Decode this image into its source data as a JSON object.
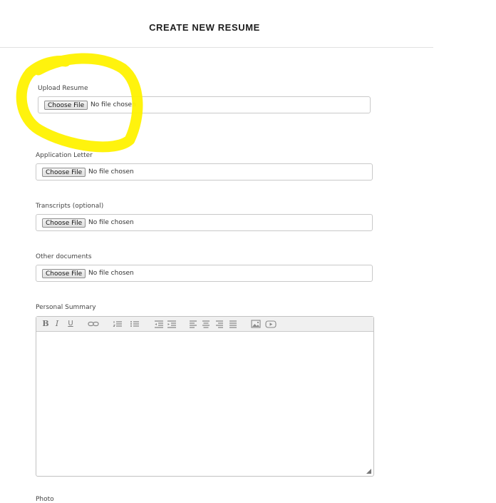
{
  "header": {
    "title": "CREATE NEW RESUME"
  },
  "fields": [
    {
      "label": "Upload Resume",
      "button": "Choose File",
      "status": "No file chosen"
    },
    {
      "label": "Application Letter",
      "button": "Choose File",
      "status": "No file chosen"
    },
    {
      "label": "Transcripts (optional)",
      "button": "Choose File",
      "status": "No file chosen"
    },
    {
      "label": "Other documents",
      "button": "Choose File",
      "status": "No file chosen"
    }
  ],
  "summary": {
    "label": "Personal Summary",
    "toolbar": {
      "bold": "B",
      "italic": "I",
      "underline": "U",
      "icons": [
        "link-icon",
        "ordered-list-icon",
        "unordered-list-icon",
        "outdent-icon",
        "indent-icon",
        "align-left-icon",
        "align-center-icon",
        "align-right-icon",
        "align-justify-icon",
        "image-icon",
        "video-icon"
      ]
    }
  },
  "next_section": {
    "label": "Photo"
  },
  "annotation": {
    "color": "#fff200"
  }
}
